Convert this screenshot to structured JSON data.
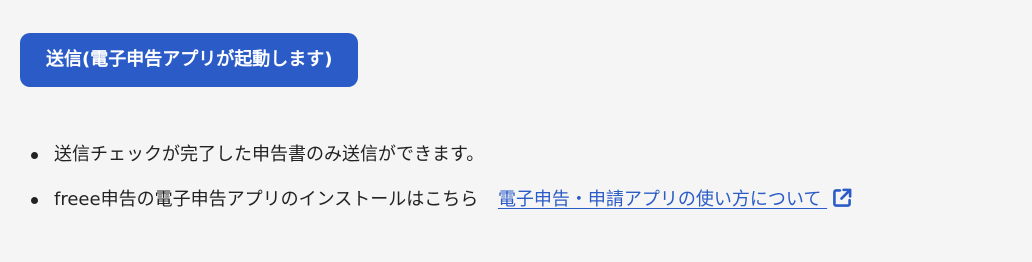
{
  "submit": {
    "label": "送信(電子申告アプリが起動します)"
  },
  "notes": [
    {
      "text": "送信チェックが完了した申告書のみ送信ができます。"
    },
    {
      "text": "freee申告の電子申告アプリのインストールはこちら",
      "link_label": "電子申告・申請アプリの使い方について",
      "link_icon": "external-link-icon"
    }
  ],
  "colors": {
    "accent": "#2a5bc7",
    "text": "#222222",
    "background": "#f5f5f5"
  }
}
